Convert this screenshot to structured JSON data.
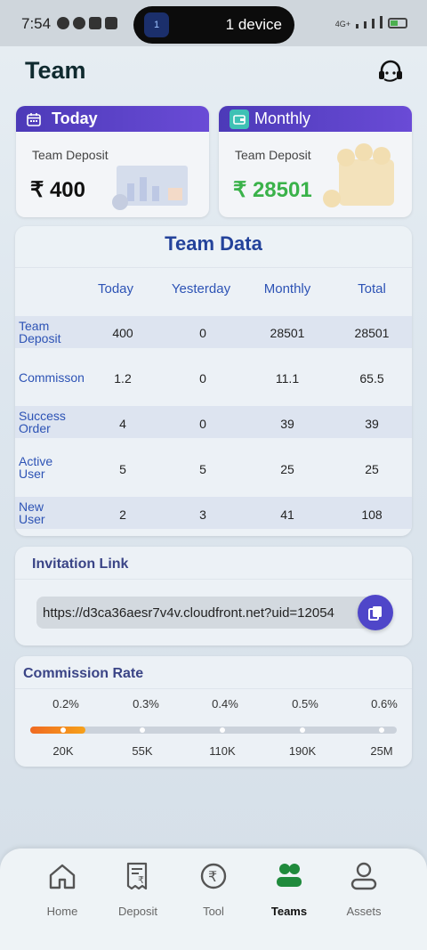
{
  "status_bar": {
    "time": "7:54",
    "pill_text": "1 device",
    "pill_badge": "1",
    "network": "4G+"
  },
  "header": {
    "title": "Team",
    "support_icon": "headset-icon"
  },
  "stats": {
    "today": {
      "title": "Today",
      "label": "Team Deposit",
      "value": "₹ 400",
      "icon": "calendar-icon"
    },
    "monthly": {
      "title": "Monthly",
      "label": "Team Deposit",
      "value": "₹ 28501",
      "icon": "wallet-icon"
    }
  },
  "team_data": {
    "title": "Team Data",
    "columns": [
      "Today",
      "Yesterday",
      "Monthly",
      "Total"
    ],
    "rows": [
      {
        "label": "Team\nDeposit",
        "values": [
          "400",
          "0",
          "28501",
          "28501"
        ]
      },
      {
        "label": "Commisson",
        "values": [
          "1.2",
          "0",
          "11.1",
          "65.5"
        ]
      },
      {
        "label": "Success\nOrder",
        "values": [
          "4",
          "0",
          "39",
          "39"
        ]
      },
      {
        "label": "Active\nUser",
        "values": [
          "5",
          "5",
          "25",
          "25"
        ]
      },
      {
        "label": "New\nUser",
        "values": [
          "2",
          "3",
          "41",
          "108"
        ]
      }
    ]
  },
  "invitation": {
    "title": "Invitation Link",
    "link": "https://d3ca36aesr7v4v.cloudfront.net?uid=12054",
    "copy_icon": "copy-icon"
  },
  "commission": {
    "title": "Commission Rate",
    "rates": [
      "0.2%",
      "0.3%",
      "0.4%",
      "0.5%",
      "0.6%"
    ],
    "levels": [
      "20K",
      "55K",
      "110K",
      "190K",
      "25M"
    ],
    "progress_fraction": 0.15,
    "colors": {
      "fill_start": "#f06a22",
      "fill_end": "#f6a11a",
      "track": "#cbd2db"
    }
  },
  "nav": {
    "items": [
      {
        "label": "Home",
        "icon": "home-icon"
      },
      {
        "label": "Deposit",
        "icon": "deposit-receipt-icon"
      },
      {
        "label": "Tool",
        "icon": "rupee-coin-icon"
      },
      {
        "label": "Teams",
        "icon": "team-icon",
        "active": true
      },
      {
        "label": "Assets",
        "icon": "user-icon"
      }
    ]
  },
  "colors": {
    "accent_purple": "#4c3ab8",
    "blue_text": "#2d53b5",
    "green_value": "#3ab24a"
  }
}
